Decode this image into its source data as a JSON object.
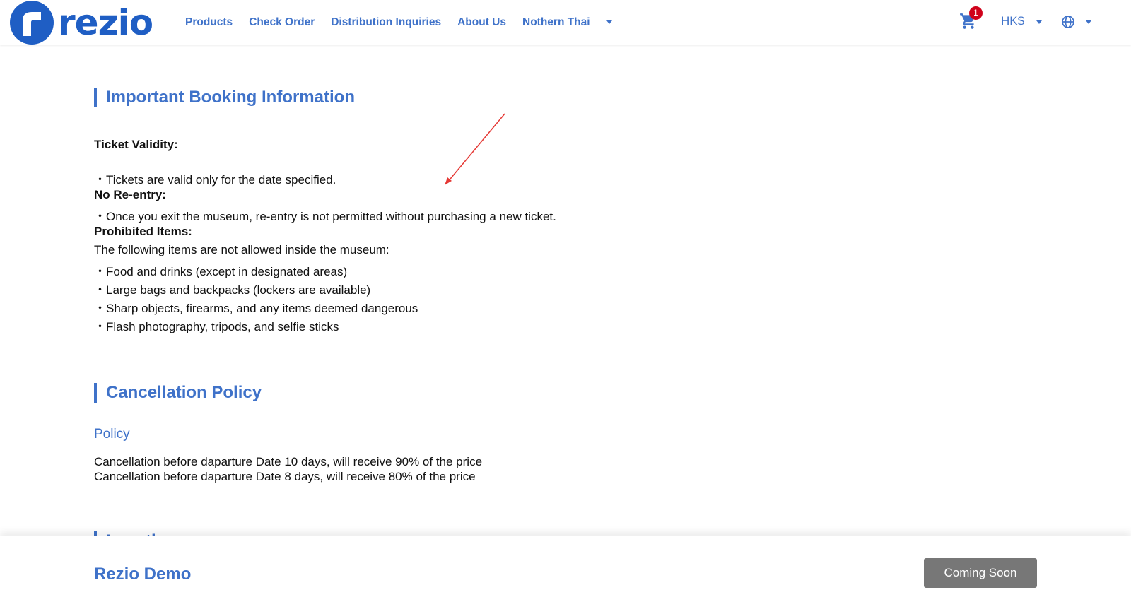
{
  "header": {
    "logo_text": "rezio",
    "nav": [
      "Products",
      "Check Order",
      "Distribution Inquiries",
      "About Us",
      "Nothern Thai"
    ],
    "cart_count": "1",
    "currency": "HK$"
  },
  "booking": {
    "title": "Important Booking Information",
    "validity_heading": "Ticket Validity:",
    "validity_item": "・Tickets are valid only for the date specified.",
    "reentry_heading": "No Re-entry:",
    "reentry_item": "・Once you exit the museum, re-entry is not permitted without purchasing a new ticket.",
    "prohibited_heading": "Prohibited Items:",
    "prohibited_intro": "The following items are not allowed inside the museum:",
    "prohibited_items": [
      "・Food and drinks (except in designated areas)",
      "・Large bags and backpacks (lockers are available)",
      "・Sharp objects, firearms, and any items deemed dangerous",
      "・Flash photography, tripods, and selfie sticks"
    ]
  },
  "cancellation": {
    "title": "Cancellation Policy",
    "policy_label": "Policy",
    "lines": [
      "Cancellation before daparture Date 10 days, will receive 90% of the price",
      "Cancellation before daparture Date 8 days, will receive 80% of the price"
    ]
  },
  "next_section": {
    "title": "Location"
  },
  "footer": {
    "title": "Rezio Demo",
    "button_label": "Coming Soon"
  },
  "colors": {
    "brand": "#3f72c9",
    "logo": "#1f5ec4",
    "badge": "#d0021b",
    "button": "#777777",
    "annotation_arrow": "#e53935"
  }
}
